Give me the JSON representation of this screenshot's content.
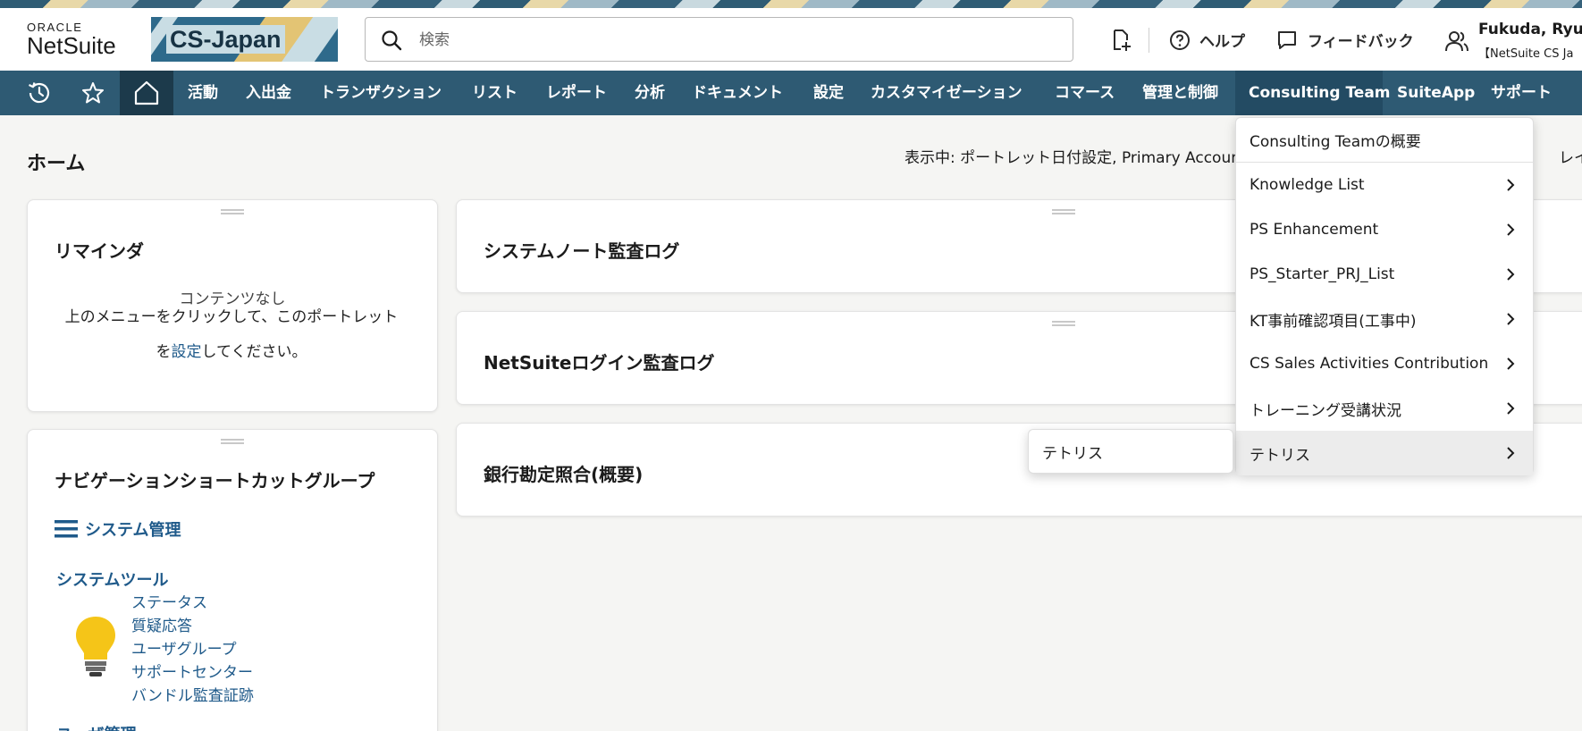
{
  "header": {
    "logo_top": "ORACLE",
    "logo_bottom": "NetSuite",
    "banner_text": "CS-Japan",
    "search_placeholder": "検索",
    "help_label": "ヘルプ",
    "feedback_label": "フィードバック",
    "user_name": "Fukuda, Ryuta",
    "user_role": "【NetSuite CS Ja"
  },
  "nav": {
    "items": [
      {
        "label": "活動"
      },
      {
        "label": "入出金"
      },
      {
        "label": "トランザクション"
      },
      {
        "label": "リスト"
      },
      {
        "label": "レポート"
      },
      {
        "label": "分析"
      },
      {
        "label": "ドキュメント"
      },
      {
        "label": "設定"
      },
      {
        "label": "カスタマイゼーション"
      },
      {
        "label": "コマース"
      },
      {
        "label": "管理と制御"
      },
      {
        "label": "Consulting Team"
      },
      {
        "label": "SuiteApp"
      },
      {
        "label": "サポート"
      }
    ],
    "active": "Consulting Team"
  },
  "page": {
    "title": "ホーム",
    "viewing": "表示中: ポートレット日付設定, Primary Accoun",
    "layout_label": "レイ"
  },
  "portlets": {
    "reminders": {
      "title": "リマインダ",
      "empty_title": "コンテンツなし",
      "empty_line1": "上のメニューをクリックして、このポートレット",
      "empty_pre": "を",
      "empty_link": "設定",
      "empty_post": "してください。"
    },
    "system_notes": {
      "title": "システムノート監査ログ"
    },
    "login_audit": {
      "title": "NetSuiteログイン監査ログ"
    },
    "bank_recon": {
      "title": "銀行勘定照合(概要)"
    },
    "nav_shortcuts": {
      "title": "ナビゲーションショートカットグループ",
      "section": "システム管理",
      "group1": "システムツール",
      "links": [
        "ステータス",
        "質疑応答",
        "ユーザグループ",
        "サポートセンター",
        "バンドル監査証跡"
      ],
      "group2": "ユーザ管理"
    }
  },
  "dropdown": {
    "items": [
      {
        "label": "Consulting Teamの概要",
        "has_submenu": false
      },
      {
        "label": "Knowledge List",
        "has_submenu": true
      },
      {
        "label": "PS Enhancement",
        "has_submenu": true
      },
      {
        "label": "PS_Starter_PRJ_List",
        "has_submenu": true
      },
      {
        "label": "KT事前確認項目(工事中)",
        "has_submenu": true
      },
      {
        "label": "CS Sales Activities Contribution",
        "has_submenu": true
      },
      {
        "label": "トレーニング受講状況",
        "has_submenu": true
      },
      {
        "label": "テトリス",
        "has_submenu": true
      }
    ],
    "hovered": "テトリス",
    "submenu_items": [
      "テトリス"
    ]
  },
  "colors": {
    "nav_bg": "#2e5a73",
    "nav_home_bg": "#1c3a4b",
    "link": "#1f5a8a",
    "bulb": "#f5c518"
  }
}
